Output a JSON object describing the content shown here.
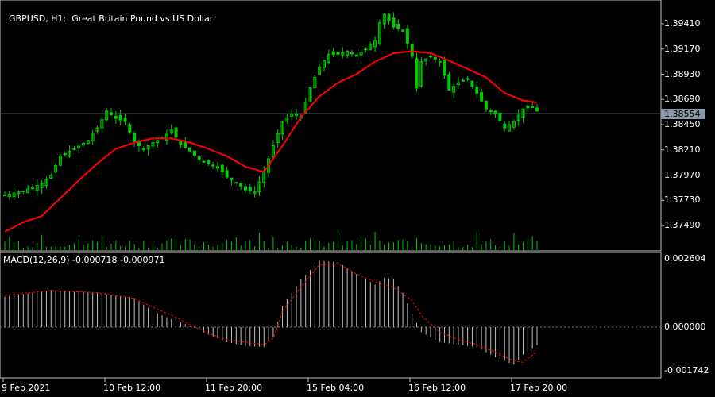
{
  "header": {
    "symbol_label": "GBPUSD, H1:",
    "description": "Great Britain Pound vs US Dollar"
  },
  "macd": {
    "label": "MACD(12,26,9) -0.000718 -0.000971",
    "main_value": -0.000718,
    "signal_value": -0.000971
  },
  "price_axis": {
    "ticks": [
      "1.39410",
      "1.39170",
      "1.38930",
      "1.38690",
      "1.38450",
      "1.38210",
      "1.37970",
      "1.37730",
      "1.37490"
    ]
  },
  "current_price": "1.38554",
  "macd_axis": {
    "ticks": [
      "0.002604",
      "0.000000",
      "-0.001742"
    ]
  },
  "time_axis": {
    "labels": [
      "9 Feb 2021",
      "10 Feb 12:00",
      "11 Feb 20:00",
      "15 Feb 04:00",
      "16 Feb 12:00",
      "17 Feb 20:00"
    ]
  },
  "colors": {
    "background": "#000000",
    "candles": "#00cc00",
    "moving_average": "#ff0000",
    "macd_histogram": "#c0c0c0",
    "macd_signal": "#ff0000",
    "grid_line": "#c0c0c0"
  },
  "chart_data": {
    "type": "candlestick",
    "symbol": "GBPUSD",
    "timeframe": "H1",
    "price_range": [
      1.3732,
      1.3962
    ],
    "close_path": [
      [
        0,
        1.3778
      ],
      [
        4,
        1.3782
      ],
      [
        8,
        1.3789
      ],
      [
        10,
        1.3797
      ],
      [
        12,
        1.3815
      ],
      [
        15,
        1.3822
      ],
      [
        18,
        1.383
      ],
      [
        20,
        1.3842
      ],
      [
        22,
        1.3858
      ],
      [
        24,
        1.3851
      ],
      [
        26,
        1.3848
      ],
      [
        28,
        1.3828
      ],
      [
        30,
        1.3822
      ],
      [
        32,
        1.3828
      ],
      [
        34,
        1.3832
      ],
      [
        36,
        1.384
      ],
      [
        38,
        1.3826
      ],
      [
        40,
        1.382
      ],
      [
        42,
        1.3812
      ],
      [
        44,
        1.3808
      ],
      [
        46,
        1.3805
      ],
      [
        48,
        1.3795
      ],
      [
        50,
        1.379
      ],
      [
        52,
        1.3783
      ],
      [
        54,
        1.3781
      ],
      [
        56,
        1.38
      ],
      [
        58,
        1.3825
      ],
      [
        60,
        1.3848
      ],
      [
        62,
        1.3855
      ],
      [
        64,
        1.3853
      ],
      [
        66,
        1.388
      ],
      [
        68,
        1.39
      ],
      [
        70,
        1.3912
      ],
      [
        72,
        1.3912
      ],
      [
        74,
        1.3915
      ],
      [
        76,
        1.391
      ],
      [
        78,
        1.3918
      ],
      [
        80,
        1.3925
      ],
      [
        81,
        1.3942
      ],
      [
        82,
        1.395
      ],
      [
        84,
        1.3938
      ],
      [
        86,
        1.3935
      ],
      [
        88,
        1.391
      ],
      [
        89,
        1.388
      ],
      [
        90,
        1.3905
      ],
      [
        92,
        1.391
      ],
      [
        94,
        1.3905
      ],
      [
        95,
        1.3892
      ],
      [
        96,
        1.3878
      ],
      [
        98,
        1.3885
      ],
      [
        100,
        1.3888
      ],
      [
        102,
        1.3875
      ],
      [
        104,
        1.386
      ],
      [
        106,
        1.3855
      ],
      [
        108,
        1.3842
      ],
      [
        110,
        1.3848
      ],
      [
        112,
        1.386
      ],
      [
        114,
        1.3862
      ],
      [
        115,
        1.3858
      ]
    ],
    "moving_average_path": [
      [
        0,
        1.3743
      ],
      [
        4,
        1.3752
      ],
      [
        8,
        1.3758
      ],
      [
        12,
        1.3775
      ],
      [
        16,
        1.3792
      ],
      [
        20,
        1.3808
      ],
      [
        24,
        1.3822
      ],
      [
        28,
        1.3828
      ],
      [
        32,
        1.3832
      ],
      [
        36,
        1.3832
      ],
      [
        40,
        1.3828
      ],
      [
        44,
        1.3822
      ],
      [
        48,
        1.3815
      ],
      [
        52,
        1.3805
      ],
      [
        56,
        1.38
      ],
      [
        60,
        1.3825
      ],
      [
        64,
        1.3852
      ],
      [
        68,
        1.3872
      ],
      [
        72,
        1.3885
      ],
      [
        76,
        1.3893
      ],
      [
        80,
        1.3905
      ],
      [
        84,
        1.3913
      ],
      [
        88,
        1.3915
      ],
      [
        92,
        1.3913
      ],
      [
        96,
        1.3906
      ],
      [
        100,
        1.3898
      ],
      [
        104,
        1.389
      ],
      [
        108,
        1.3875
      ],
      [
        112,
        1.3868
      ],
      [
        115,
        1.3866
      ]
    ],
    "macd_range": [
      -0.001742,
      0.002604
    ],
    "macd_histogram_path": [
      [
        0,
        0.00115
      ],
      [
        10,
        0.0014
      ],
      [
        20,
        0.00128
      ],
      [
        28,
        0.0011
      ],
      [
        32,
        0.0006
      ],
      [
        36,
        0.0003
      ],
      [
        40,
        5e-05
      ],
      [
        44,
        -0.0003
      ],
      [
        48,
        -0.0006
      ],
      [
        52,
        -0.00075
      ],
      [
        56,
        -0.0008
      ],
      [
        58,
        -0.0004
      ],
      [
        60,
        0.0008
      ],
      [
        64,
        0.0018
      ],
      [
        68,
        0.0025
      ],
      [
        72,
        0.00245
      ],
      [
        76,
        0.002
      ],
      [
        80,
        0.0016
      ],
      [
        82,
        0.00185
      ],
      [
        84,
        0.0018
      ],
      [
        86,
        0.0013
      ],
      [
        88,
        0.0005
      ],
      [
        90,
        -0.0002
      ],
      [
        94,
        -0.0006
      ],
      [
        98,
        -0.0007
      ],
      [
        102,
        -0.0008
      ],
      [
        106,
        -0.0012
      ],
      [
        110,
        -0.0015
      ],
      [
        112,
        -0.0011
      ],
      [
        115,
        -0.00072
      ]
    ],
    "macd_signal_path": [
      [
        0,
        0.0012
      ],
      [
        10,
        0.00138
      ],
      [
        20,
        0.0013
      ],
      [
        28,
        0.00108
      ],
      [
        32,
        0.00075
      ],
      [
        36,
        0.00045
      ],
      [
        40,
        0.0001
      ],
      [
        44,
        -0.00025
      ],
      [
        48,
        -0.0005
      ],
      [
        52,
        -0.0006
      ],
      [
        56,
        -0.0007
      ],
      [
        58,
        -0.00045
      ],
      [
        60,
        0.0006
      ],
      [
        64,
        0.0015
      ],
      [
        68,
        0.00235
      ],
      [
        72,
        0.0024
      ],
      [
        76,
        0.002
      ],
      [
        80,
        0.0017
      ],
      [
        84,
        0.0015
      ],
      [
        88,
        0.001
      ],
      [
        90,
        0.00045
      ],
      [
        94,
        -0.0002
      ],
      [
        98,
        -0.0005
      ],
      [
        102,
        -0.0007
      ],
      [
        106,
        -0.001
      ],
      [
        110,
        -0.00135
      ],
      [
        112,
        -0.0014
      ],
      [
        115,
        -0.00097
      ]
    ]
  }
}
